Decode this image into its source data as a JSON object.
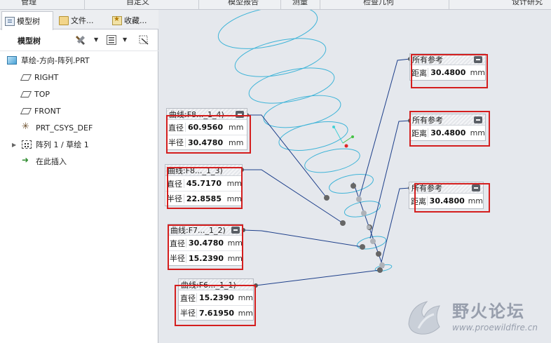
{
  "ribbon": {
    "items": [
      "管理",
      "自定义",
      "模型报告",
      "测量",
      "检查几何",
      "设计研究"
    ]
  },
  "left_panel": {
    "tabs": [
      {
        "label": "模型树",
        "icon": "model-tree-icon"
      },
      {
        "label": "文件...",
        "icon": "folder-icon"
      },
      {
        "label": "收藏...",
        "icon": "favorites-icon"
      }
    ],
    "toolbar_title": "模型树",
    "tree": [
      {
        "label": "草绘-方向-阵列.PRT",
        "icon": "part-icon"
      },
      {
        "label": "RIGHT",
        "icon": "datum-plane-icon"
      },
      {
        "label": "TOP",
        "icon": "datum-plane-icon"
      },
      {
        "label": "FRONT",
        "icon": "datum-plane-icon"
      },
      {
        "label": "PRT_CSYS_DEF",
        "icon": "csys-icon"
      },
      {
        "label": "阵列 1 / 草绘 1",
        "icon": "pattern-icon"
      },
      {
        "label": "在此插入",
        "icon": "insert-here-arrow-icon"
      }
    ]
  },
  "annotations": {
    "curve1": {
      "title": "曲线:F8..._1_4)",
      "rows": [
        {
          "label": "直径",
          "value": "60.9560",
          "unit": "mm"
        },
        {
          "label": "半径",
          "value": "30.4780",
          "unit": "mm"
        }
      ]
    },
    "curve2": {
      "title": "曲线:F8..._1_3)",
      "rows": [
        {
          "label": "直径",
          "value": "45.7170",
          "unit": "mm"
        },
        {
          "label": "半径",
          "value": "22.8585",
          "unit": "mm"
        }
      ]
    },
    "curve3": {
      "title": "曲线:F7..._1_2)",
      "rows": [
        {
          "label": "直径",
          "value": "30.4780",
          "unit": "mm"
        },
        {
          "label": "半径",
          "value": "15.2390",
          "unit": "mm"
        }
      ]
    },
    "curve4": {
      "title": "曲线:F6..._1_1)",
      "rows": [
        {
          "label": "直径",
          "value": "15.2390",
          "unit": "mm"
        },
        {
          "label": "半径",
          "value": "7.61950",
          "unit": "mm"
        }
      ]
    },
    "ref1": {
      "title": "所有参考",
      "rows": [
        {
          "label": "距离",
          "value": "30.4800",
          "unit": "mm"
        }
      ]
    },
    "ref2": {
      "title": "所有参考",
      "rows": [
        {
          "label": "距离",
          "value": "30.4800",
          "unit": "mm"
        }
      ]
    },
    "ref3": {
      "title": "所有参考",
      "rows": [
        {
          "label": "距离",
          "value": "30.4800",
          "unit": "mm"
        }
      ]
    }
  },
  "watermark": {
    "title": "野火论坛",
    "url": "www.proewildfire.cn"
  },
  "colors": {
    "curve": "#3fb4d8",
    "highlight_box": "#d41e1e",
    "leader": "#1d3f8a"
  }
}
